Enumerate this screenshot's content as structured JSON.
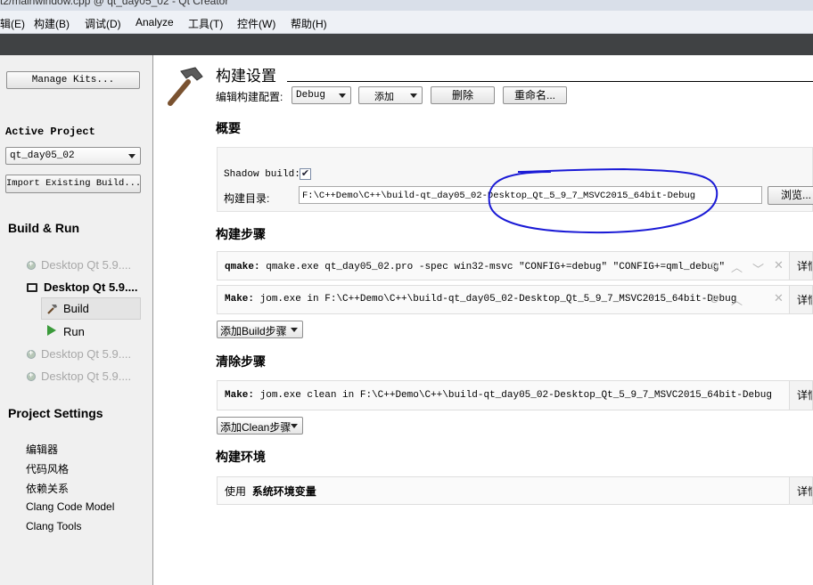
{
  "window": {
    "title_partial": "t2/mainwindow.cpp @ qt_day05_02 - Qt Creator"
  },
  "menu": [
    "辑(E)",
    "构建(B)",
    "调试(D)",
    "Analyze",
    "工具(T)",
    "控件(W)",
    "帮助(H)"
  ],
  "sidebar": {
    "manage_kits": "Manage Kits...",
    "active_project_label": "Active Project",
    "project_combo": "qt_day05_02",
    "import_button": "Import Existing Build...",
    "build_run_title": "Build & Run",
    "targets": [
      "Desktop Qt 5.9....",
      "Desktop Qt 5.9....",
      "Desktop Qt 5.9....",
      "Desktop Qt 5.9...."
    ],
    "active_target": "Desktop Qt 5.9....",
    "build_label": "Build",
    "run_label": "Run",
    "project_settings_title": "Project Settings",
    "settings": [
      "编辑器",
      "代码风格",
      "依赖关系",
      "Clang Code Model",
      "Clang Tools"
    ]
  },
  "main": {
    "title": "构建设置",
    "edit_config_label": "编辑构建配置:",
    "config_value": "Debug",
    "add_button": "添加",
    "delete_button": "删除",
    "rename_button": "重命名...",
    "overview_title": "概要",
    "shadow_build_label": "Shadow build:",
    "build_dir_label": "构建目录:",
    "build_dir_value": "F:\\C++Demo\\C++\\build-qt_day05_02-Desktop_Qt_5_9_7_MSVC2015_64bit-Debug",
    "browse_button": "浏览...",
    "build_steps_title": "构建步骤",
    "build_steps": [
      {
        "tool": "qmake:",
        "command": "qmake.exe qt_day05_02.pro -spec win32-msvc \"CONFIG+=debug\" \"CONFIG+=qml_debug\""
      },
      {
        "tool": "Make:",
        "command": "jom.exe in F:\\C++Demo\\C++\\build-qt_day05_02-Desktop_Qt_5_9_7_MSVC2015_64bit-Debug"
      }
    ],
    "add_build_step": "添加Build步骤",
    "clean_steps_title": "清除步骤",
    "clean_step": {
      "tool": "Make:",
      "command": "jom.exe clean in F:\\C++Demo\\C++\\build-qt_day05_02-Desktop_Qt_5_9_7_MSVC2015_64bit-Debug"
    },
    "add_clean_step": "添加Clean步骤",
    "env_title": "构建环境",
    "env_prefix": "使用",
    "env_value": "系统环境变量",
    "details_label": "详情"
  },
  "colors": {
    "annotation": "#1a1ad6",
    "dark_bar": "#404244",
    "menu_bg": "#eef1f6"
  }
}
